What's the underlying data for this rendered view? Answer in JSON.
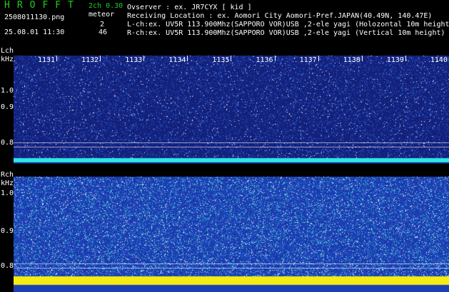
{
  "header": {
    "brand": "HROFFT",
    "version": "2ch 0.30",
    "filename": "2508011130.png",
    "meteor_label": "meteor",
    "datetime": "25.08.01 11:30",
    "count_l": "2",
    "count_r": "46",
    "observer_line": "Ovserver           : ex. JR7CYX [ kid ]",
    "location_line": "Receiving Location : ex. Aomori City Aomori-Pref.JAPAN(40.49N, 140.47E)",
    "lch_line": "L-ch:ex. UV5R 113.900Mhz(SAPPORO VOR)USB ,2-ele yagi (Holozontal 10m height)",
    "rch_line": "R-ch:ex. UV5R 113.900Mhz(SAPPORO VOR)USB ,2-ele yagi (Vertical 10m height)",
    "colors": {
      "brand": "#22cc22",
      "meta": "#ffffff",
      "version": "#ffffff"
    }
  },
  "lch": {
    "label": "Lch",
    "unit": "kHz",
    "minutes": [
      "1131",
      "1132",
      "1133",
      "1134",
      "1135",
      "1136",
      "1137",
      "1138",
      "1139",
      "1140"
    ],
    "freq_ticks": [
      "1.0",
      "0.9",
      "0.8"
    ]
  },
  "rch": {
    "label": "Rch",
    "unit": "kHz",
    "freq_ticks": [
      "1.0",
      "0.9",
      "0.8"
    ]
  },
  "colors": {
    "l_bg": "#13207a",
    "r_bg": "#1d3fb6",
    "l_noise": "#3c7ee8",
    "r_noise": "#36c8d8",
    "l_band": "#2fe6e6",
    "r_band": "#f4ec12"
  }
}
